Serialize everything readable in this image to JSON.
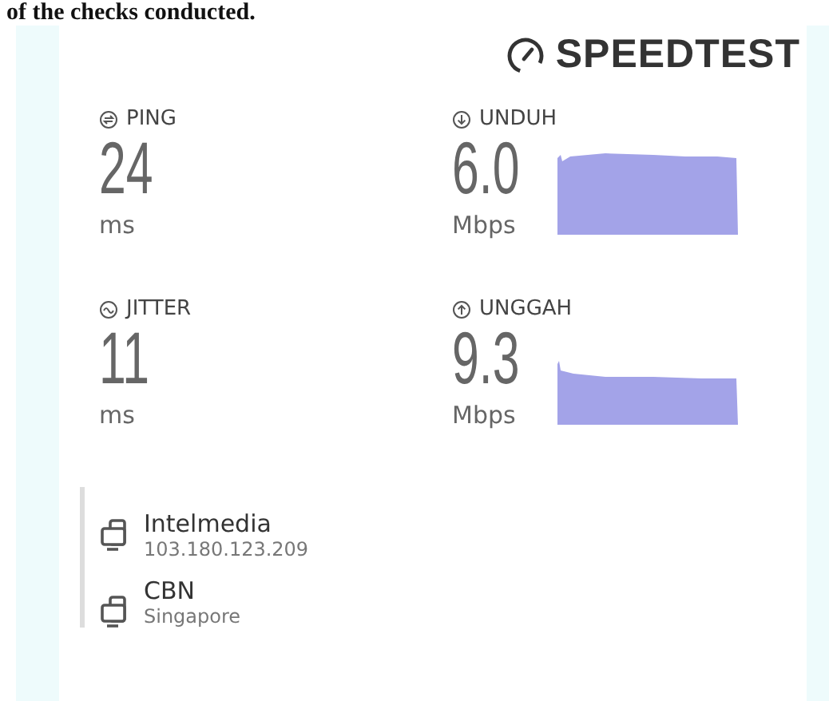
{
  "caption": "of the checks conducted.",
  "logo": {
    "text": "SPEEDTEST"
  },
  "metrics": [
    {
      "kind": "ping",
      "label": "PING",
      "value": "24",
      "unit": "ms"
    },
    {
      "kind": "download",
      "label": "UNDUH",
      "value": "6.0",
      "unit": "Mbps"
    },
    {
      "kind": "jitter",
      "label": "JITTER",
      "value": "11",
      "unit": "ms"
    },
    {
      "kind": "upload",
      "label": "UNGGAH",
      "value": "9.3",
      "unit": "Mbps"
    }
  ],
  "servers": [
    {
      "name": "Intelmedia",
      "detail": "103.180.123.209"
    },
    {
      "name": "CBN",
      "detail": "Singapore"
    }
  ]
}
